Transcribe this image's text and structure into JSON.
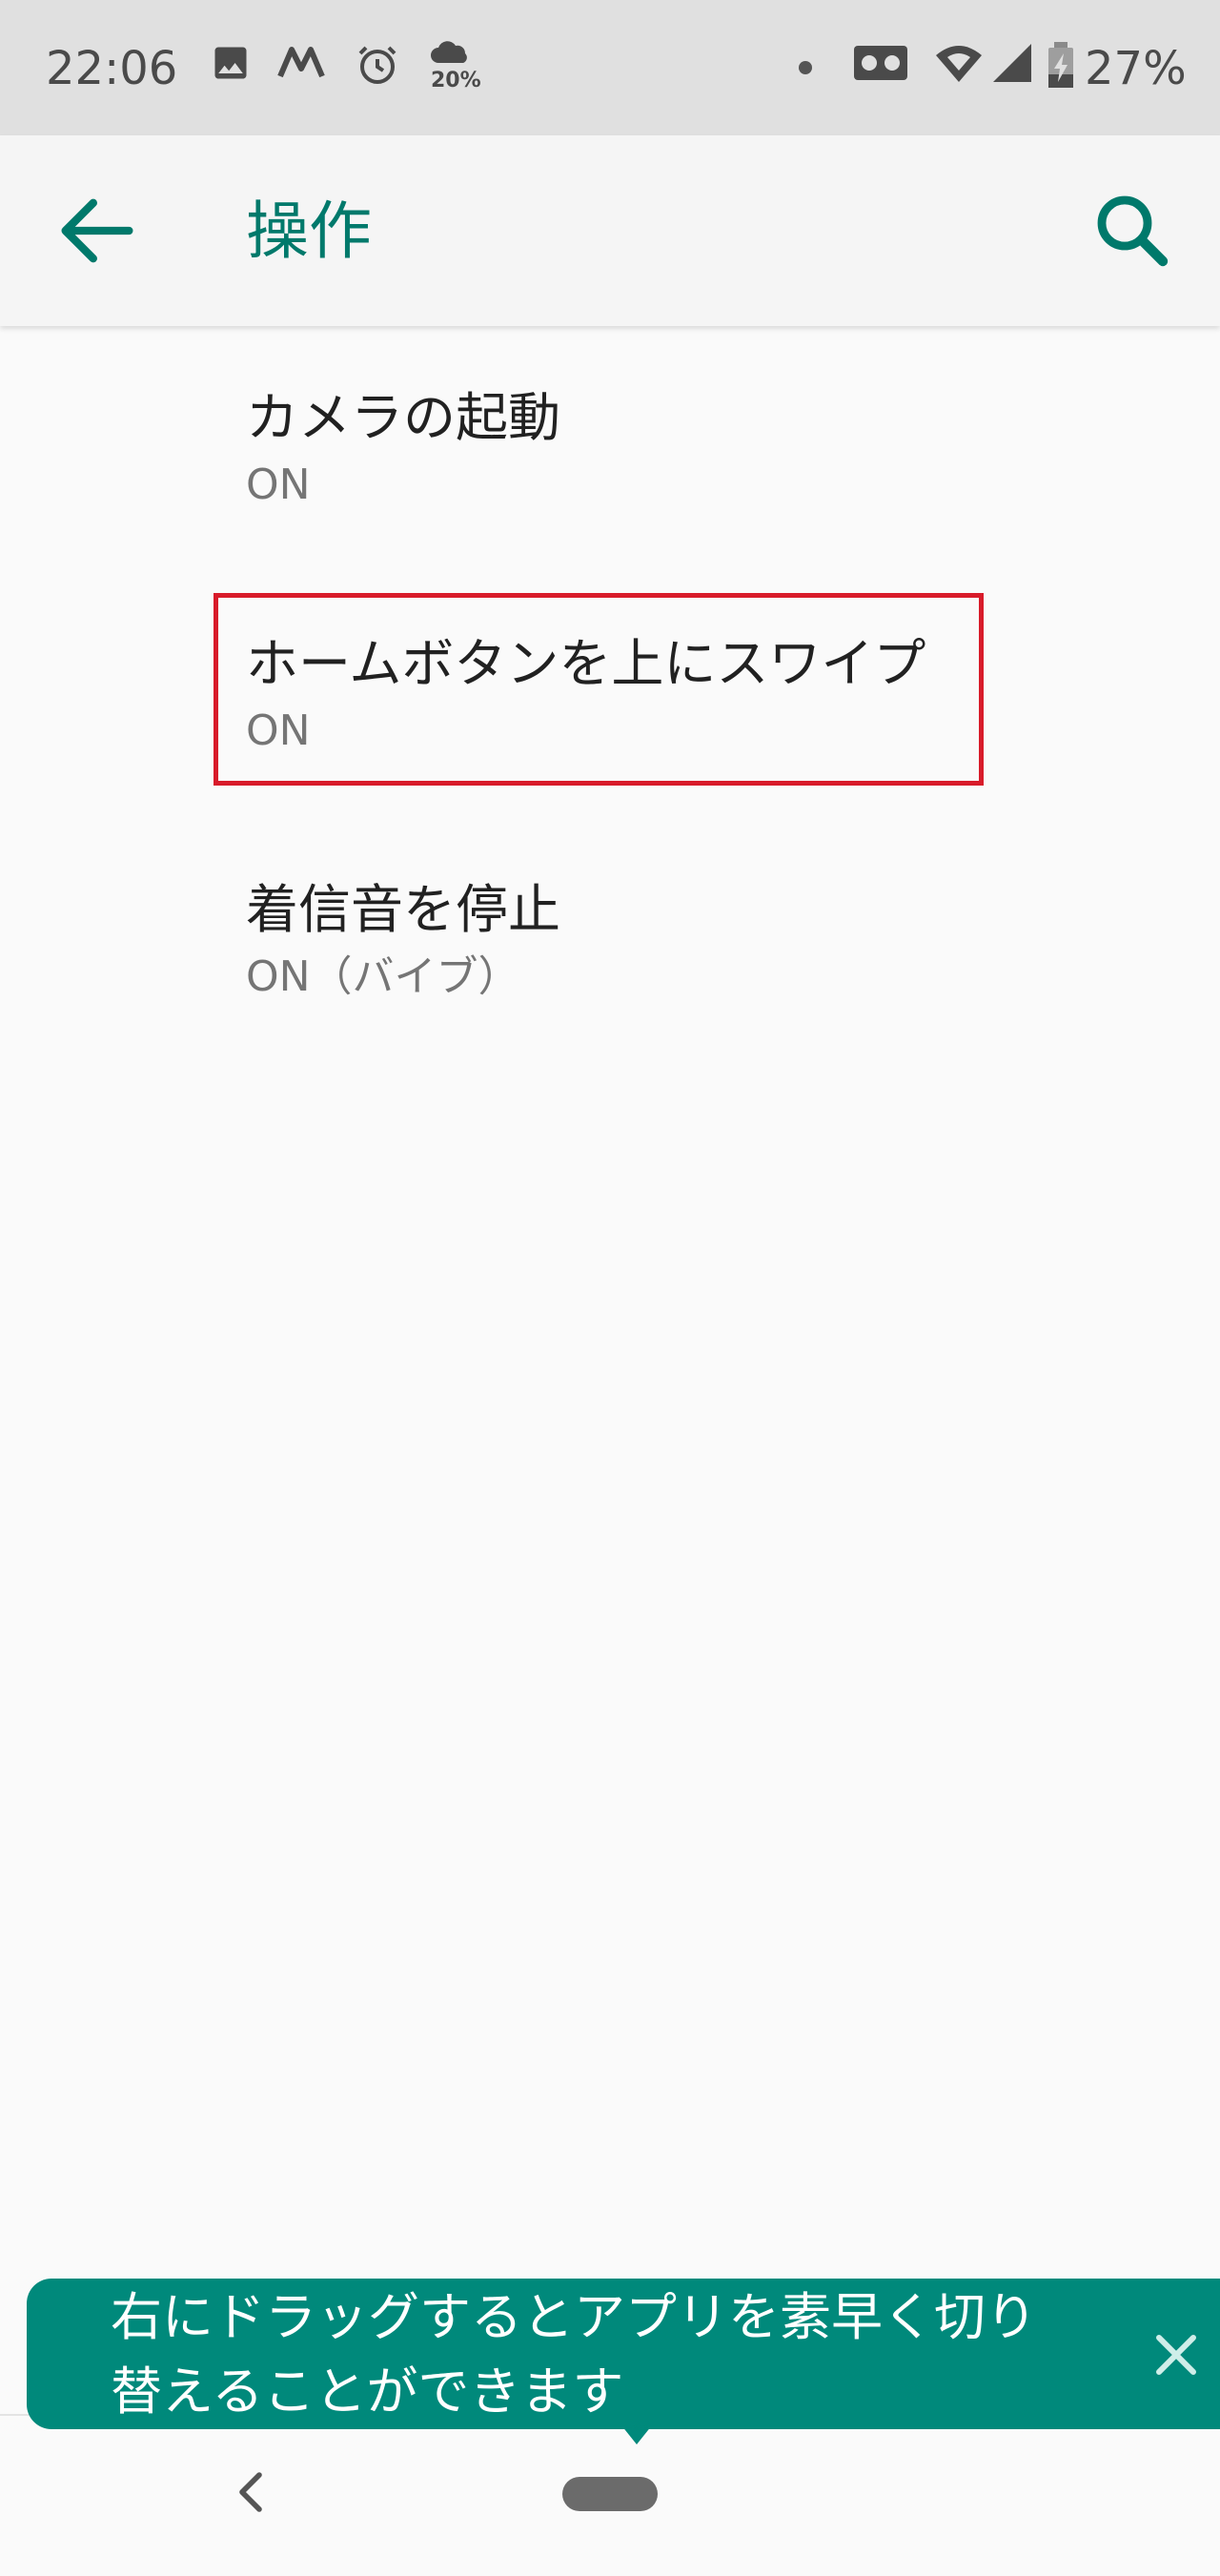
{
  "status_bar": {
    "time": "22:06",
    "weather_percent": "20%",
    "battery_percent": "27%",
    "icons": [
      "image-icon",
      "m-app-icon",
      "alarm-icon",
      "weather-icon",
      "dot-icon",
      "voicemail-icon",
      "wifi-icon",
      "signal-icon",
      "battery-charging-icon"
    ]
  },
  "app_bar": {
    "title": "操作",
    "back_icon": "arrow-left-icon",
    "search_icon": "search-icon"
  },
  "settings": {
    "items": [
      {
        "title": "カメラの起動",
        "subtitle": "ON"
      },
      {
        "title": "ホームボタンを上にスワイプ",
        "subtitle": "ON"
      },
      {
        "title": "着信音を停止",
        "subtitle": "ON（バイブ）"
      }
    ]
  },
  "tooltip": {
    "line1": "右にドラッグするとアプリを素早く切り",
    "line2": "替えることができます",
    "close_icon": "close-icon"
  },
  "nav_bar": {
    "back_icon": "chevron-left-icon",
    "home_icon": "home-pill-icon"
  },
  "colors": {
    "accent": "#00796b",
    "tooltip_bg": "#00897b",
    "highlight": "#d81b2a",
    "status_bar_bg": "#e0e0e0"
  }
}
